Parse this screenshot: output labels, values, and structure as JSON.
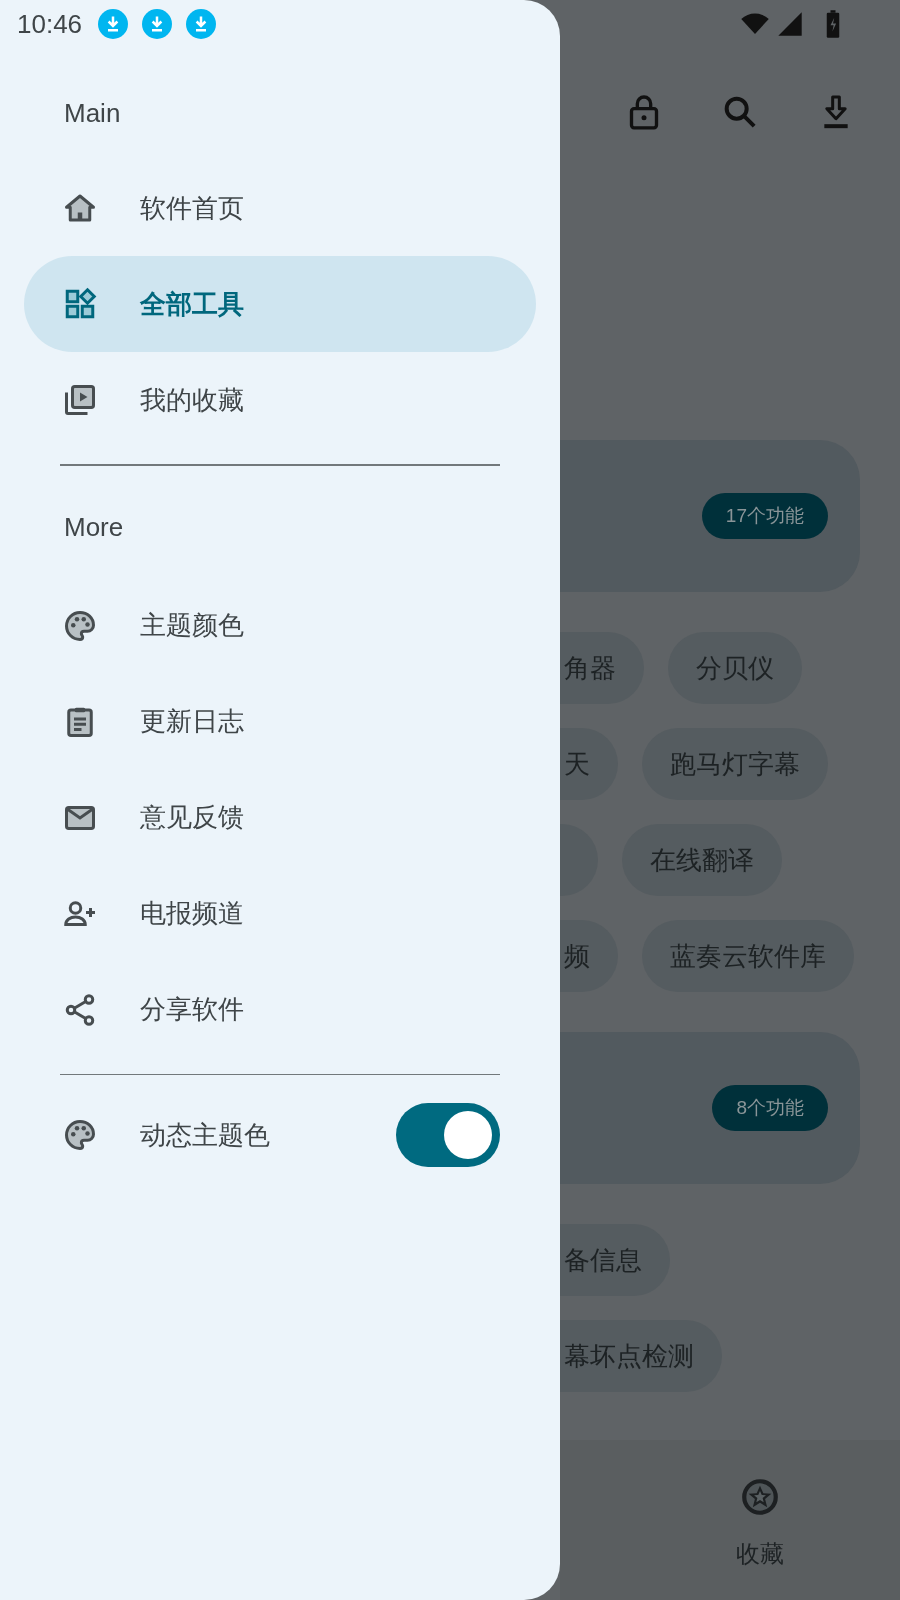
{
  "status_bar": {
    "time": "10:46",
    "notification_icons": [
      {
        "kind": "download"
      },
      {
        "kind": "download"
      },
      {
        "kind": "download"
      }
    ]
  },
  "drawer": {
    "sections": [
      {
        "title": "Main",
        "items": [
          {
            "label": "软件首页",
            "selected": false
          },
          {
            "label": "全部工具",
            "selected": true
          },
          {
            "label": "我的收藏",
            "selected": false
          }
        ]
      },
      {
        "title": "More",
        "items": [
          {
            "label": "主题颜色",
            "selected": false
          },
          {
            "label": "更新日志",
            "selected": false
          },
          {
            "label": "意见反馈",
            "selected": false
          },
          {
            "label": "电报频道",
            "selected": false
          },
          {
            "label": "分享软件",
            "selected": false
          }
        ]
      }
    ],
    "toggle": {
      "label": "动态主题色",
      "on": true
    }
  },
  "background": {
    "toolbar_icons": [
      {
        "kind": "lock"
      },
      {
        "kind": "search"
      },
      {
        "kind": "download"
      }
    ],
    "groups": [
      {
        "badge": "17个功能",
        "chip_rows": [
          [
            {
              "kind": "cut",
              "label": "角器"
            },
            {
              "kind": "full",
              "label": "分贝仪"
            }
          ],
          [
            {
              "kind": "cut",
              "label": "天"
            },
            {
              "kind": "full",
              "label": "跑马灯字幕"
            }
          ],
          [
            {
              "kind": "cut"
            },
            {
              "kind": "full",
              "label": "在线翻译"
            }
          ],
          [
            {
              "kind": "cut",
              "label": "频"
            },
            {
              "kind": "full",
              "label": "蓝奏云软件库"
            }
          ]
        ]
      },
      {
        "badge": "8个功能",
        "chip_rows": [
          [
            {
              "kind": "cut",
              "label": "备信息"
            }
          ],
          [
            {
              "kind": "cut",
              "label": "幕坏点检测"
            }
          ]
        ]
      }
    ],
    "bottom_nav": [
      {
        "label": "收藏"
      }
    ]
  }
}
